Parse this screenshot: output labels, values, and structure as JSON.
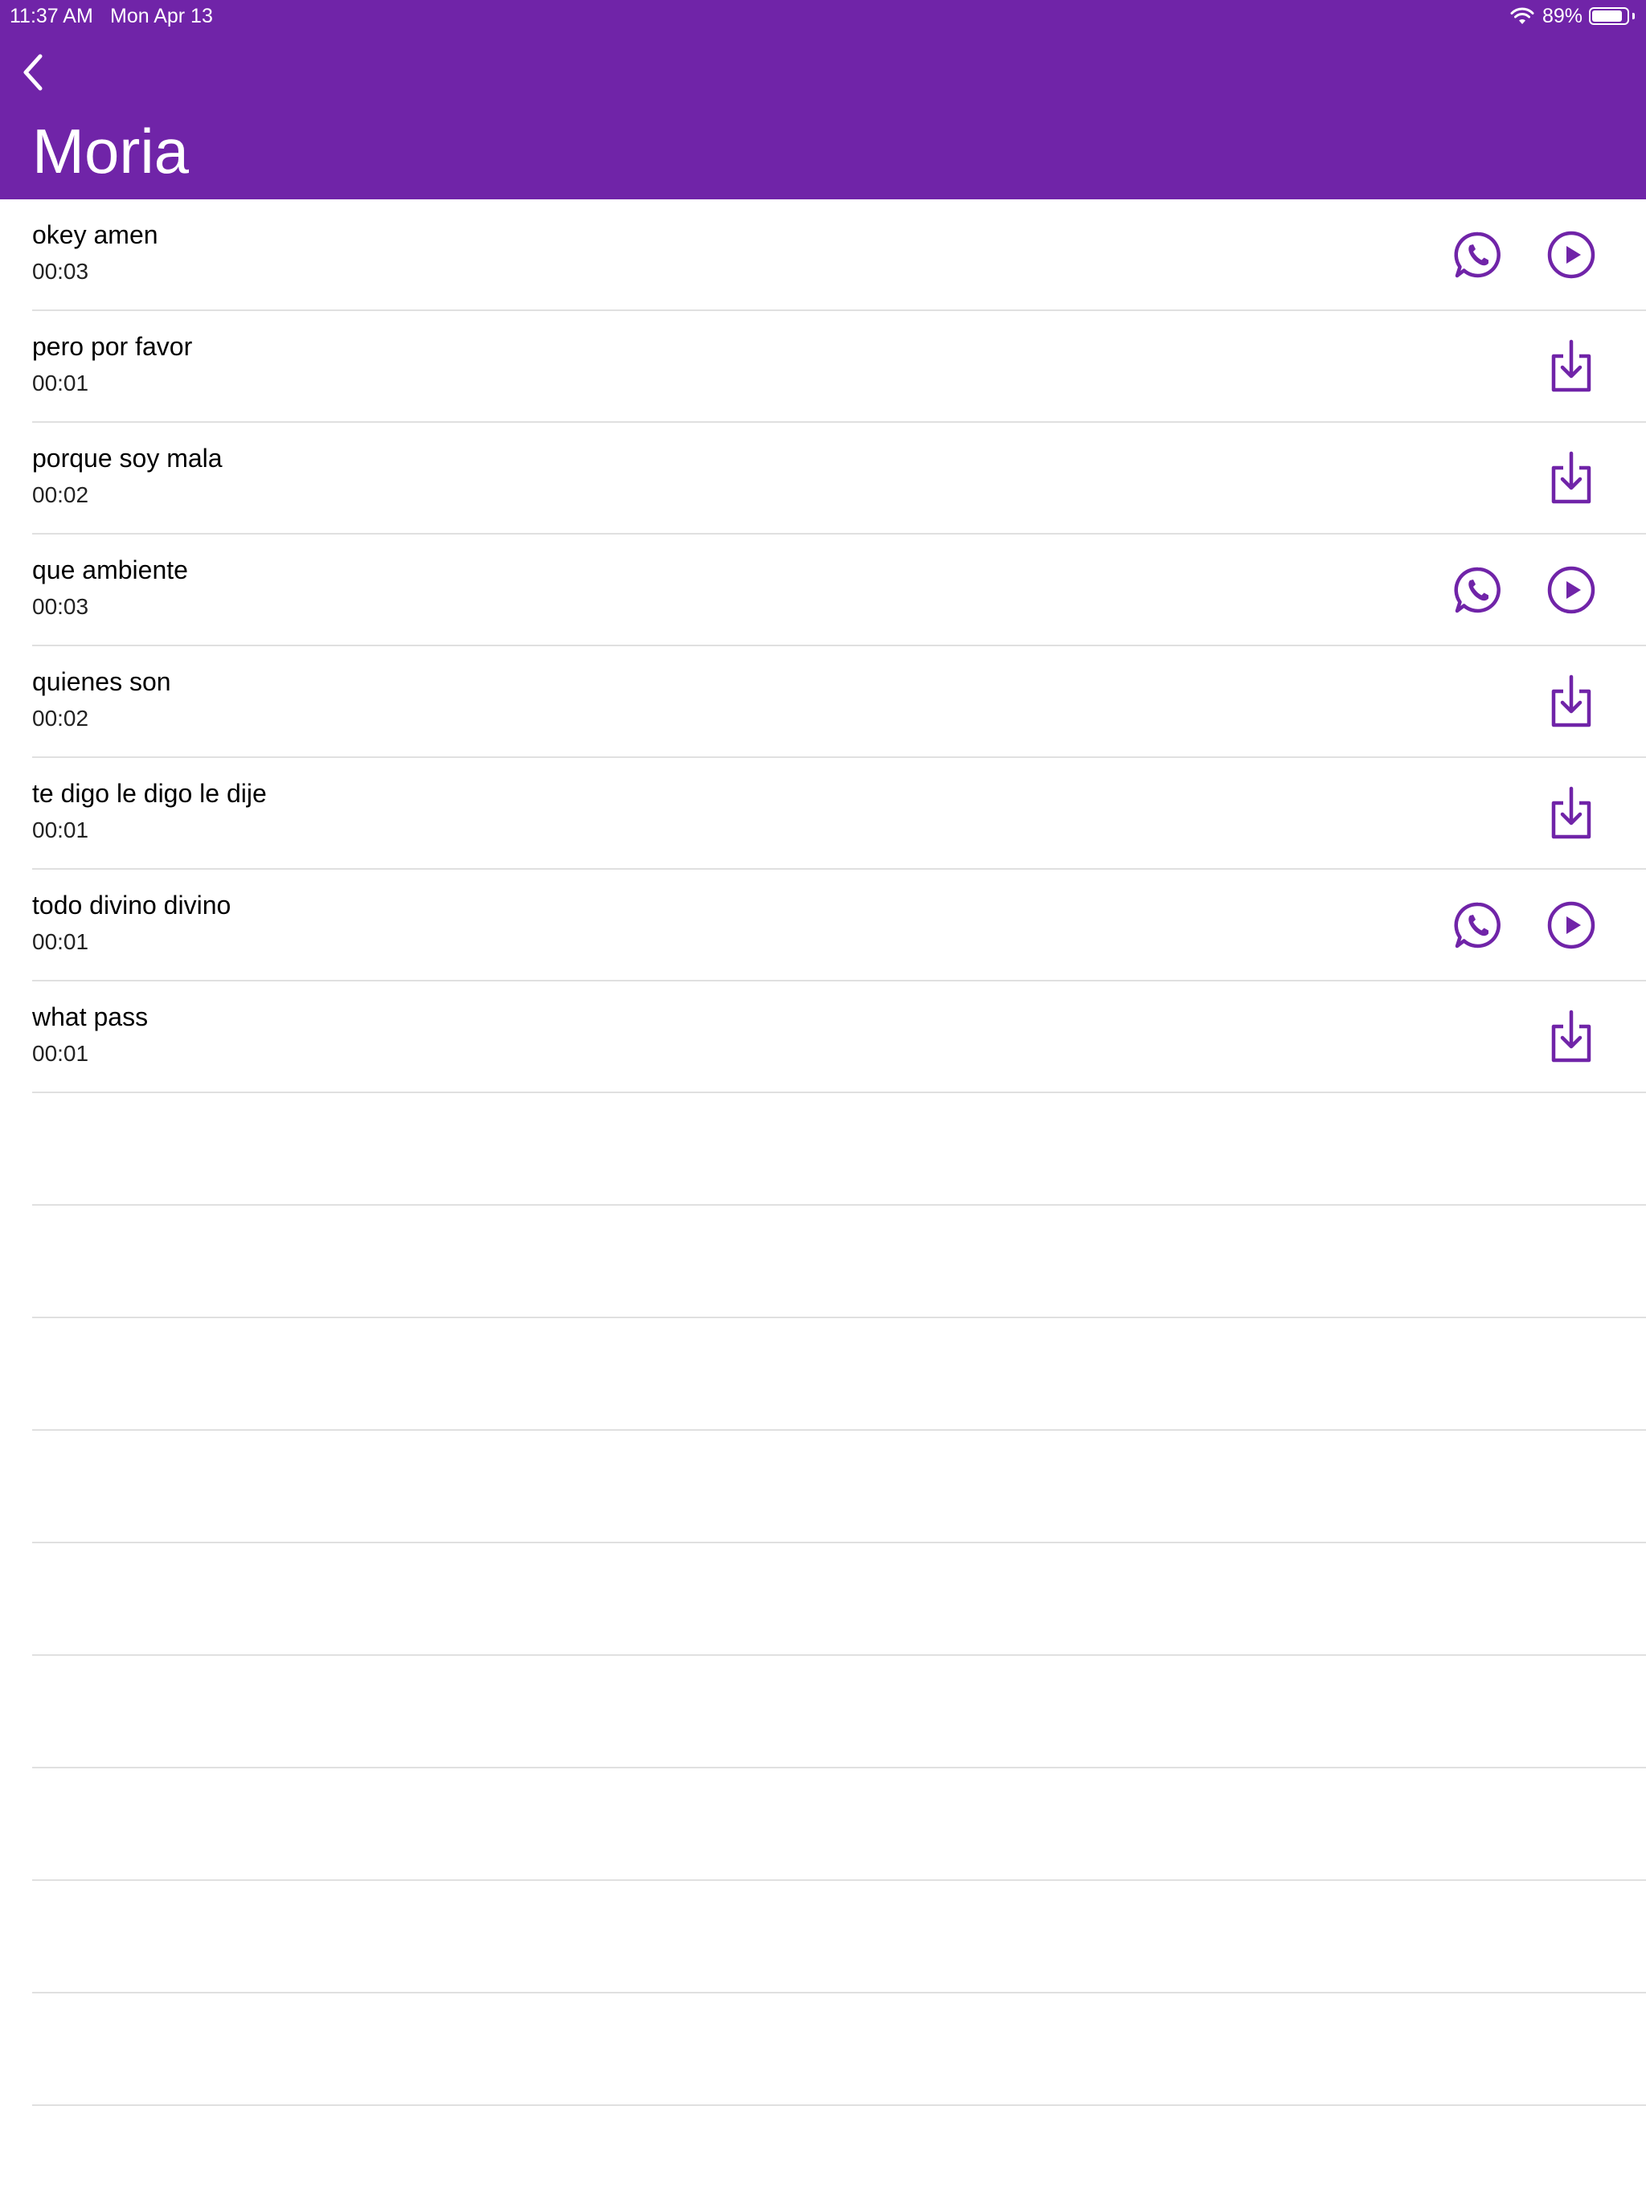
{
  "status_bar": {
    "time": "11:37 AM",
    "date": "Mon Apr 13",
    "battery_percent": "89%",
    "battery_level": 0.89
  },
  "header": {
    "back_icon": "chevron-left-icon",
    "title": "Moria"
  },
  "colors": {
    "accent": "#7024a8",
    "divider": "#e0e0e0"
  },
  "sounds": [
    {
      "title": "okey amen",
      "duration": "00:03",
      "state": "downloaded"
    },
    {
      "title": "pero por favor",
      "duration": "00:01",
      "state": "download"
    },
    {
      "title": "porque soy mala",
      "duration": "00:02",
      "state": "download"
    },
    {
      "title": "que ambiente",
      "duration": "00:03",
      "state": "downloaded"
    },
    {
      "title": "quienes son",
      "duration": "00:02",
      "state": "download"
    },
    {
      "title": "te digo le digo le dije",
      "duration": "00:01",
      "state": "download"
    },
    {
      "title": "todo divino divino",
      "duration": "00:01",
      "state": "downloaded"
    },
    {
      "title": "what pass",
      "duration": "00:01",
      "state": "download"
    }
  ]
}
